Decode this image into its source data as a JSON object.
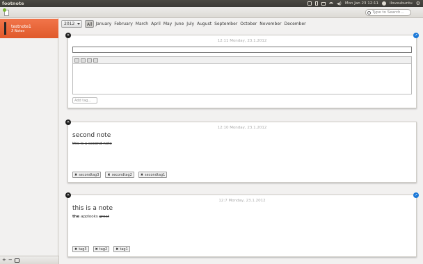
{
  "topbar": {
    "app_title": "footnote",
    "datetime": "Mon Jan 23 12:11",
    "user": "iloveubuntu"
  },
  "toolbar": {
    "search_placeholder": "Type to Search..."
  },
  "sidebar": {
    "notebooks": [
      {
        "name": "testnote1",
        "count": "3 Notes"
      }
    ],
    "footer": {
      "add": "+",
      "remove": "−"
    }
  },
  "filter": {
    "year": "2012",
    "months": [
      "All",
      "January",
      "February",
      "March",
      "April",
      "May",
      "June",
      "July",
      "August",
      "September",
      "October",
      "November",
      "December"
    ],
    "selected": "All"
  },
  "notes": [
    {
      "date": "12:11 Monday, 23.1.2012",
      "title": "",
      "add_tag_placeholder": "Add tag..."
    },
    {
      "date": "12:10 Monday, 23.1.2012",
      "title": "second note",
      "body": "this is a second note",
      "tags": [
        "secondtag3",
        "secondtag2",
        "secondtag1"
      ]
    },
    {
      "date": "12:7 Monday, 23.1.2012",
      "title": "this is a note",
      "body": {
        "the": "the",
        "app": "app",
        "looks": "looks",
        "great": "great"
      },
      "tags": [
        "tag3",
        "tag2",
        "tag1"
      ]
    }
  ]
}
